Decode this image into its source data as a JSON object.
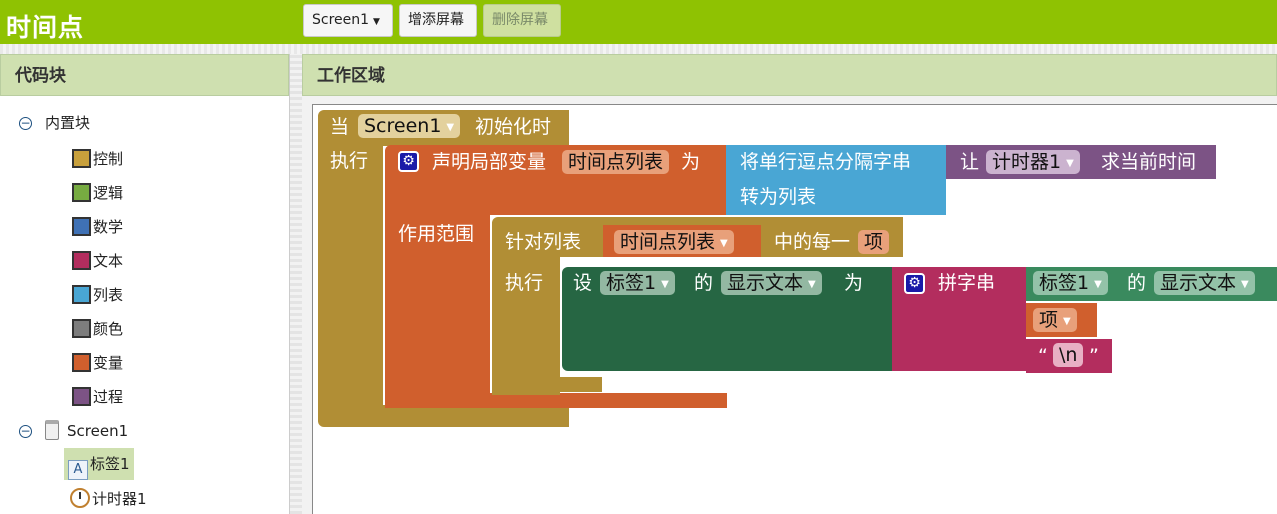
{
  "app": {
    "title": "时间点"
  },
  "toolbar": {
    "screen_select": "Screen1",
    "add_screen": "增添屏幕",
    "remove_screen": "删除屏幕"
  },
  "blocks_panel": {
    "title": "代码块",
    "builtin": {
      "label": "内置块",
      "items": [
        {
          "label": "控制",
          "color": "#c8a03c"
        },
        {
          "label": "逻辑",
          "color": "#77ab41"
        },
        {
          "label": "数学",
          "color": "#3f71b5"
        },
        {
          "label": "文本",
          "color": "#b32d5e"
        },
        {
          "label": "列表",
          "color": "#49a6d4"
        },
        {
          "label": "颜色",
          "color": "#7d7d7d"
        },
        {
          "label": "变量",
          "color": "#d05f2d"
        },
        {
          "label": "过程",
          "color": "#7c5385"
        }
      ]
    },
    "screen": {
      "label": "Screen1",
      "components": [
        "标签1",
        "计时器1"
      ]
    }
  },
  "workspace": {
    "title": "工作区域",
    "colors": {
      "control": "#b18e35",
      "variable": "#d05f2d",
      "list": "#49a6d4",
      "clock": "#7c5385",
      "label_comp": "#266643",
      "text": "#b32d5e"
    },
    "blocks": {
      "when": "当",
      "screen": "Screen1",
      "initialize": "初始化时",
      "do": "执行",
      "declare_local": "声明局部变量",
      "var_name": "时间点列表",
      "as": "为",
      "split_csv_1": "将单行逗点分隔字串",
      "split_csv_2": "转为列表",
      "let": "让",
      "clock_comp": "计时器1",
      "now": "求当前时间",
      "scope": "作用范围",
      "for_each_list": "针对列表",
      "get_var": "时间点列表",
      "each_of": "中的每一",
      "item": "项",
      "do2": "执行",
      "set": "设",
      "label_comp": "标签1",
      "of": "的",
      "prop": "显示文本",
      "to": "为",
      "join": "拼字串",
      "label_comp2": "标签1",
      "of2": "的",
      "prop2": "显示文本",
      "item_get": "项",
      "quote_open": "“",
      "newline": "\\n",
      "quote_close": "”"
    }
  }
}
